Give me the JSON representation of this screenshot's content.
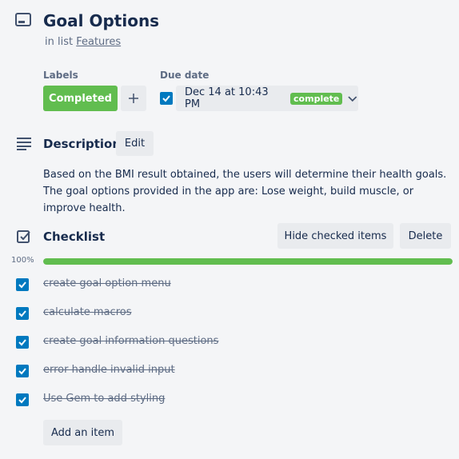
{
  "card": {
    "title": "Goal Options",
    "in_list_prefix": "in list",
    "list_name": "Features"
  },
  "labels": {
    "heading": "Labels",
    "items": [
      {
        "name": "Completed",
        "color": "#61bd4f"
      }
    ],
    "add_icon": "plus-icon"
  },
  "due_date": {
    "heading": "Due date",
    "checked": true,
    "value": "Dec 14 at 10:43 PM",
    "badge": "complete",
    "badge_color": "#61bd4f"
  },
  "description": {
    "heading": "Description",
    "edit_label": "Edit",
    "text": "Based on the BMI result obtained, the users will determine their health goals. The goal options provided in the app are: Lose weight, build muscle, or improve health."
  },
  "checklist": {
    "heading": "Checklist",
    "hide_label": "Hide checked items",
    "delete_label": "Delete",
    "progress_label": "100%",
    "progress": 1.0,
    "progress_color": "#61bd4f",
    "items": [
      {
        "text": "create goal option menu",
        "checked": true
      },
      {
        "text": "calculate macros",
        "checked": true
      },
      {
        "text": "create goal information questions",
        "checked": true
      },
      {
        "text": "error handle invalid input",
        "checked": true
      },
      {
        "text": "Use Gem to add styling",
        "checked": true
      }
    ],
    "add_item_label": "Add an item"
  },
  "colors": {
    "accent": "#0079bf",
    "background": "#f4f5f7",
    "button": "#e9ebee"
  }
}
